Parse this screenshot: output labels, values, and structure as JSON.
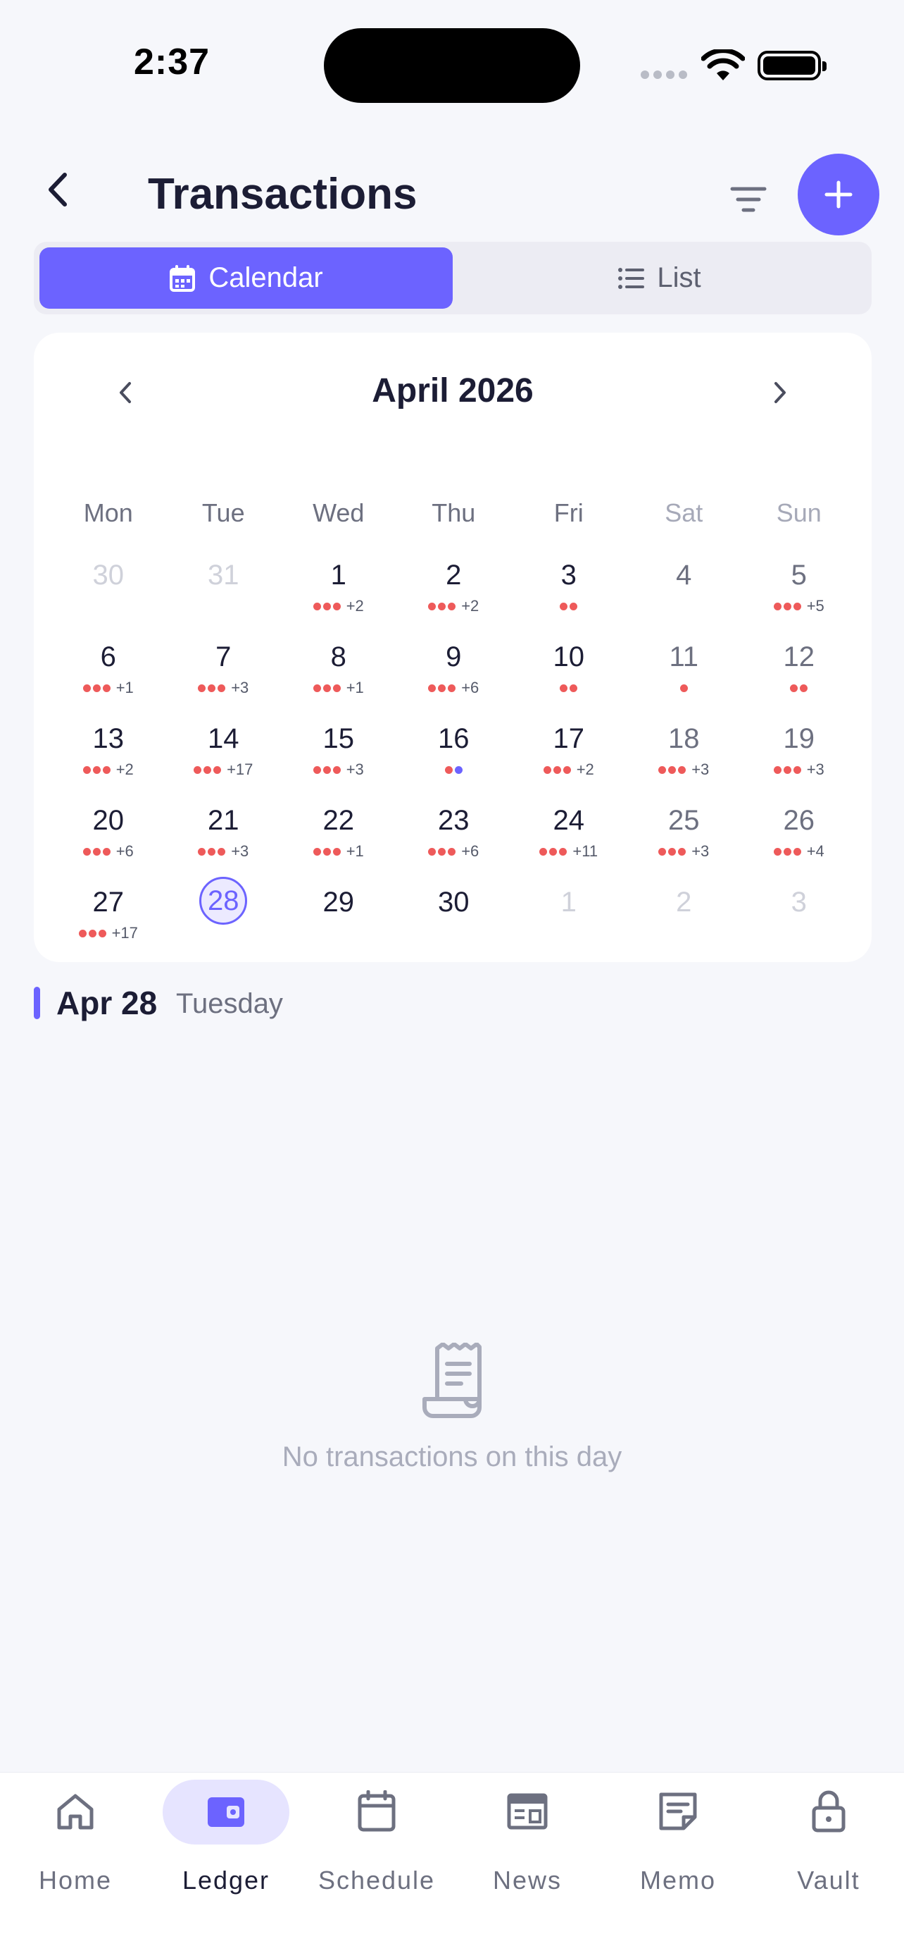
{
  "status": {
    "time": "2:37"
  },
  "header": {
    "title": "Transactions"
  },
  "view_toggle": {
    "calendar_label": "Calendar",
    "list_label": "List",
    "selected": "Calendar"
  },
  "calendar": {
    "month_title": "April 2026",
    "weekdays": [
      "Mon",
      "Tue",
      "Wed",
      "Thu",
      "Fri",
      "Sat",
      "Sun"
    ],
    "weeks": [
      [
        {
          "day": "30",
          "outside": true
        },
        {
          "day": "31",
          "outside": true
        },
        {
          "day": "1",
          "dots": 3,
          "more": "+2"
        },
        {
          "day": "2",
          "dots": 3,
          "more": "+2"
        },
        {
          "day": "3",
          "dots": 2
        },
        {
          "day": "4"
        },
        {
          "day": "5",
          "dots": 3,
          "more": "+5"
        }
      ],
      [
        {
          "day": "6",
          "dots": 3,
          "more": "+1"
        },
        {
          "day": "7",
          "dots": 3,
          "more": "+3"
        },
        {
          "day": "8",
          "dots": 3,
          "more": "+1"
        },
        {
          "day": "9",
          "dots": 3,
          "more": "+6"
        },
        {
          "day": "10",
          "dots": 2
        },
        {
          "day": "11",
          "dots": 1
        },
        {
          "day": "12",
          "dots": 2
        }
      ],
      [
        {
          "day": "13",
          "dots": 3,
          "more": "+2"
        },
        {
          "day": "14",
          "dots": 3,
          "more": "+17"
        },
        {
          "day": "15",
          "dots": 3,
          "more": "+3"
        },
        {
          "day": "16",
          "dots": 2,
          "mixed": true
        },
        {
          "day": "17",
          "dots": 3,
          "more": "+2"
        },
        {
          "day": "18",
          "dots": 3,
          "more": "+3"
        },
        {
          "day": "19",
          "dots": 3,
          "more": "+3"
        }
      ],
      [
        {
          "day": "20",
          "dots": 3,
          "more": "+6"
        },
        {
          "day": "21",
          "dots": 3,
          "more": "+3"
        },
        {
          "day": "22",
          "dots": 3,
          "more": "+1"
        },
        {
          "day": "23",
          "dots": 3,
          "more": "+6"
        },
        {
          "day": "24",
          "dots": 3,
          "more": "+11"
        },
        {
          "day": "25",
          "dots": 3,
          "more": "+3"
        },
        {
          "day": "26",
          "dots": 3,
          "more": "+4"
        }
      ],
      [
        {
          "day": "27",
          "dots": 3,
          "more": "+17"
        },
        {
          "day": "28",
          "today": true
        },
        {
          "day": "29"
        },
        {
          "day": "30"
        },
        {
          "day": "1",
          "outside": true
        },
        {
          "day": "2",
          "outside": true
        },
        {
          "day": "3",
          "outside": true
        }
      ]
    ],
    "colors": {
      "accent": "#6c63ff",
      "expense_dot": "#ee5a5a",
      "income_dot": "#6c63ff"
    }
  },
  "selected_day": {
    "date": "Apr 28",
    "weekday": "Tuesday"
  },
  "empty_state": {
    "icon": "receipt-icon",
    "message": "No transactions on this day"
  },
  "bottom_nav": {
    "items": [
      {
        "label": "Home",
        "icon": "home-icon"
      },
      {
        "label": "Ledger",
        "icon": "wallet-icon",
        "active": true
      },
      {
        "label": "Schedule",
        "icon": "calendar-icon"
      },
      {
        "label": "News",
        "icon": "newspaper-icon"
      },
      {
        "label": "Memo",
        "icon": "note-icon"
      },
      {
        "label": "Vault",
        "icon": "lock-icon"
      }
    ]
  }
}
